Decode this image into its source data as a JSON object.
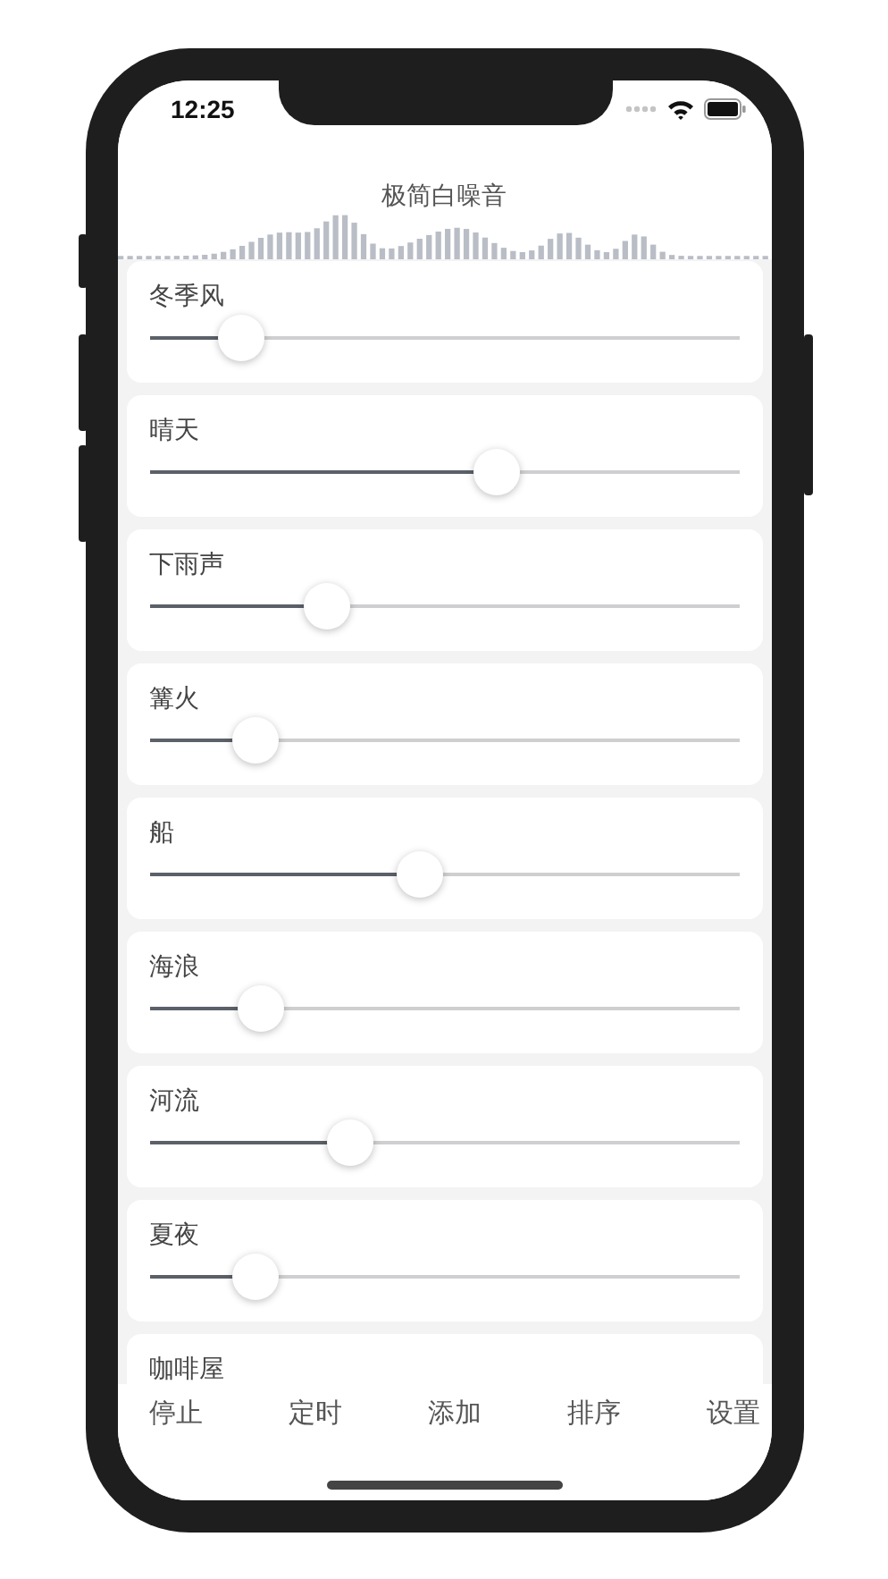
{
  "status_bar": {
    "time": "12:25"
  },
  "title": "极简白噪音",
  "sounds": [
    {
      "name": "冬季风",
      "level": 0.155
    },
    {
      "name": "晴天",
      "level": 0.59
    },
    {
      "name": "下雨声",
      "level": 0.3
    },
    {
      "name": "篝火",
      "level": 0.18
    },
    {
      "name": "船",
      "level": 0.46
    },
    {
      "name": "海浪",
      "level": 0.19
    },
    {
      "name": "河流",
      "level": 0.34
    },
    {
      "name": "夏夜",
      "level": 0.18
    },
    {
      "name": "咖啡屋"
    }
  ],
  "tabs": [
    "停止",
    "定时",
    "添加",
    "排序",
    "设置"
  ]
}
